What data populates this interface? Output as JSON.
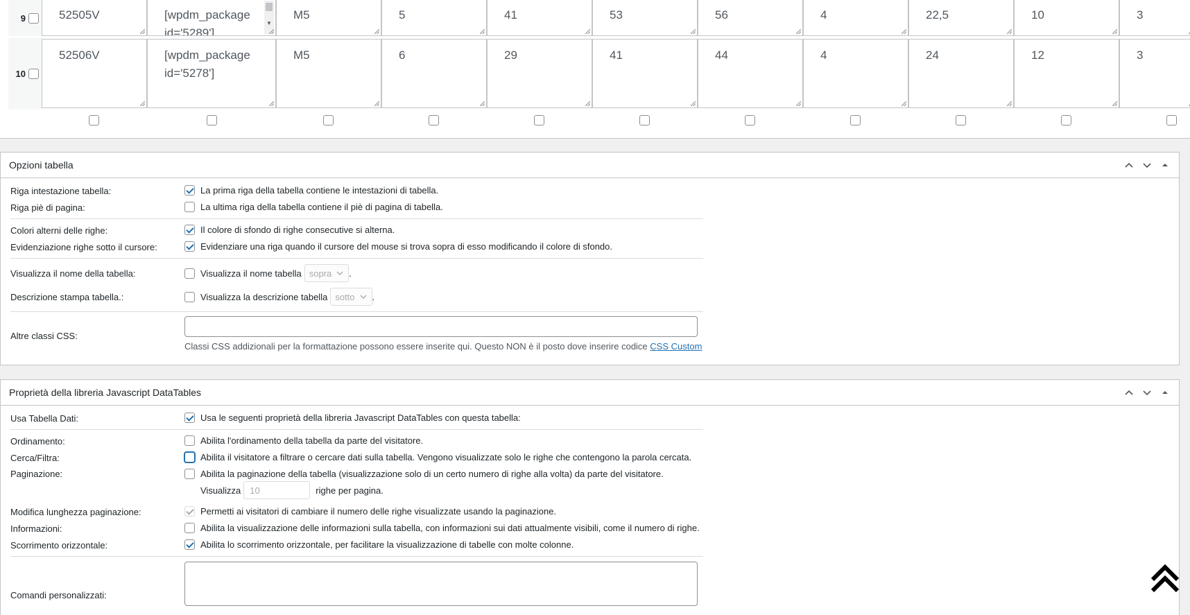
{
  "grid": {
    "rows": [
      {
        "num": "9",
        "cells": [
          "52505V",
          "[wpdm_package id='5289']",
          "M5",
          "5",
          "41",
          "53",
          "56",
          "4",
          "22,5",
          "10",
          "3"
        ]
      },
      {
        "num": "10",
        "cells": [
          "52506V",
          "[wpdm_package id='5278']",
          "M5",
          "6",
          "29",
          "41",
          "44",
          "4",
          "24",
          "12",
          "3"
        ]
      }
    ]
  },
  "table_options": {
    "title": "Opzioni tabella",
    "header_row_label": "Riga intestazione tabella:",
    "header_row_text": "La prima riga della tabella contiene le intestazioni di tabella.",
    "footer_row_label": "Riga piè di pagina:",
    "footer_row_text": "La ultima riga della tabella contiene il piè di pagina di tabella.",
    "alt_colors_label": "Colori alterni delle righe:",
    "alt_colors_text": "Il colore di sfondo di righe consecutive si alterna.",
    "hover_label": "Evidenziazione righe sotto il cursore:",
    "hover_text": "Evidenziare una riga quando il cursore del mouse si trova sopra di esso modificando il colore di sfondo.",
    "show_name_label": "Visualizza il nome della tabella:",
    "show_name_text": "Visualizza il nome tabella",
    "show_name_position": "sopra",
    "show_desc_label": "Descrizione stampa tabella.:",
    "show_desc_text": "Visualizza la descrizione tabella",
    "show_desc_position": "sotto",
    "css_label": "Altre classi CSS:",
    "css_hint": "Classi CSS addizionali per la formattazione possono essere inserite qui. Questo NON è il posto dove inserire codice",
    "css_link": "CSS Custom"
  },
  "datatables": {
    "title": "Proprietà della libreria Javascript DataTables",
    "use_label": "Usa Tabella Dati:",
    "use_text": "Usa le seguenti proprietà della libreria Javascript DataTables con questa tabella:",
    "sort_label": "Ordinamento:",
    "sort_text": "Abilita l'ordinamento della tabella da parte del visitatore.",
    "filter_label": "Cerca/Filtra:",
    "filter_text": "Abilita il visitatore a filtrare o cercare dati sulla tabella. Vengono visualizzate solo le righe che contengono la parola cercata.",
    "paging_label": "Paginazione:",
    "paging_text": "Abilita la paginazione della tabella (visualizzazione solo di un certo numero di righe alla volta) da parte del visitatore.",
    "paging_show": "Visualizza",
    "paging_value": "10",
    "paging_suffix": "righe per pagina.",
    "length_label": "Modifica lunghezza paginazione:",
    "length_text": "Permetti ai visitatori di cambiare il numero delle righe visualizzate usando la paginazione.",
    "info_label": "Informazioni:",
    "info_text": "Abilita la visualizzazione delle informazioni sulla tabella, con informazioni sui dati attualmente visibili, come il numero di righe.",
    "scroll_label": "Scorrimento orizzontale:",
    "scroll_text": "Abilita lo scorrimento orizzontale, per facilitare la visualizzazione di tabelle con molte colonne.",
    "custom_label": "Comandi personalizzati:"
  }
}
